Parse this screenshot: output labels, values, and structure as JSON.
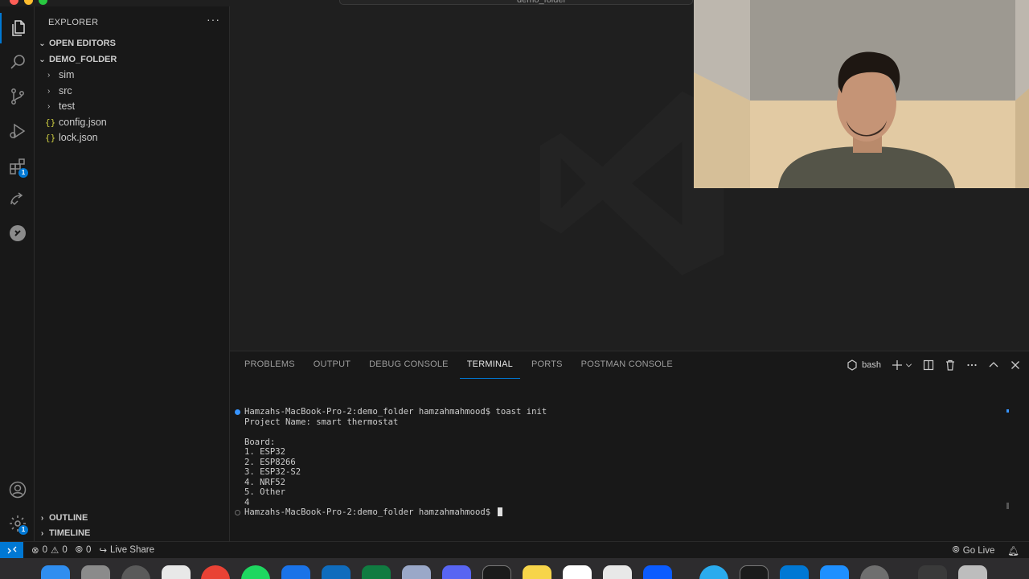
{
  "window": {
    "title": "demo_folder"
  },
  "colors": {
    "accent": "#0078d4",
    "json_icon": "#cbcb41",
    "bg": "#181818",
    "editor_bg": "#1f1f1f"
  },
  "activity_bar": {
    "items": [
      {
        "icon": "files-icon",
        "active": true
      },
      {
        "icon": "search-icon"
      },
      {
        "icon": "source-control-icon"
      },
      {
        "icon": "run-debug-icon"
      },
      {
        "icon": "extensions-icon",
        "badge": "1"
      },
      {
        "icon": "remote-explorer-icon"
      },
      {
        "icon": "postman-icon"
      }
    ],
    "bottom": [
      {
        "icon": "accounts-icon"
      },
      {
        "icon": "manage-gear-icon",
        "badge": "1"
      }
    ]
  },
  "sidebar": {
    "title": "EXPLORER",
    "more": "···",
    "open_editors": "OPEN EDITORS",
    "folder": "DEMO_FOLDER",
    "items": [
      {
        "type": "folder",
        "label": "sim"
      },
      {
        "type": "folder",
        "label": "src"
      },
      {
        "type": "folder",
        "label": "test"
      },
      {
        "type": "file",
        "label": "config.json",
        "icon": "{}"
      },
      {
        "type": "file",
        "label": "lock.json",
        "icon": "{}"
      }
    ],
    "outline": "OUTLINE",
    "timeline": "TIMELINE"
  },
  "panel": {
    "tabs": [
      {
        "label": "PROBLEMS"
      },
      {
        "label": "OUTPUT"
      },
      {
        "label": "DEBUG CONSOLE"
      },
      {
        "label": "TERMINAL",
        "active": true
      },
      {
        "label": "PORTS"
      },
      {
        "label": "POSTMAN CONSOLE"
      }
    ],
    "shell": "bash"
  },
  "terminal": {
    "lines": [
      "Hamzahs-MacBook-Pro-2:demo_folder hamzahmahmood$ toast init",
      "Project Name: smart thermostat",
      "",
      "Board:",
      "1. ESP32",
      "2. ESP8266",
      "3. ESP32-S2",
      "4. NRF52",
      "5. Other",
      "4",
      "Hamzahs-MacBook-Pro-2:demo_folder hamzahmahmood$ "
    ]
  },
  "status_bar": {
    "errors": "0",
    "warnings": "0",
    "ports": "0",
    "live_share": "Live Share",
    "go_live": "Go Live"
  }
}
